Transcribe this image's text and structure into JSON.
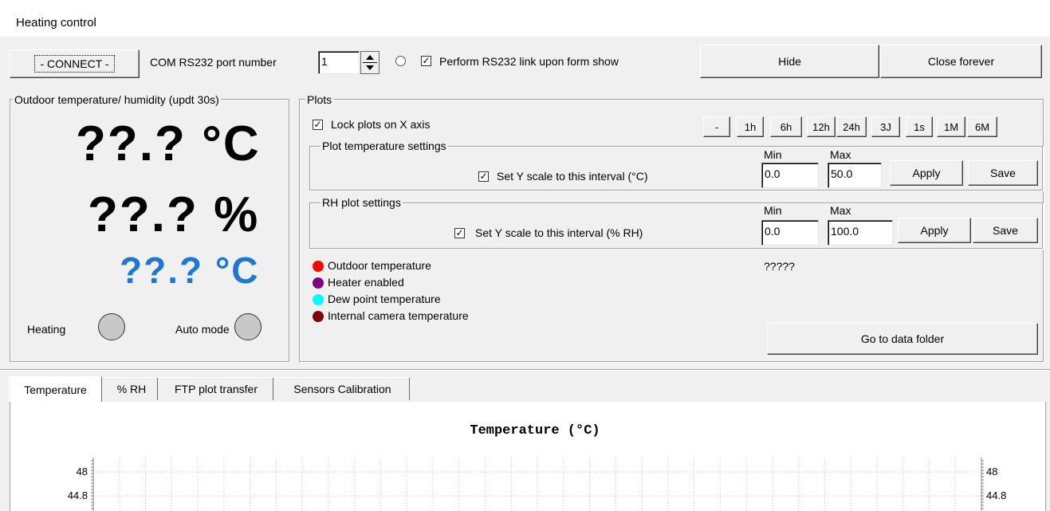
{
  "window": {
    "title": "Heating control"
  },
  "toolbar": {
    "connect_label": "- CONNECT -",
    "com_label": "COM  RS232 port number",
    "port_value": "1",
    "perform_link_label": "Perform RS232 link upon form show",
    "perform_link_checked": true,
    "hide_label": "Hide",
    "close_label": "Close forever"
  },
  "outdoor": {
    "group_title": "Outdoor temperature/ humidity (updt 30s)",
    "temperature": "??.? °C",
    "humidity": "??.? %",
    "dew_point": "??.? °C",
    "heating_label": "Heating",
    "auto_mode_label": "Auto mode"
  },
  "plots": {
    "group_title": "Plots",
    "lock_label": "Lock plots on X axis",
    "lock_checked": true,
    "range_buttons": [
      "-",
      "1h",
      "6h",
      "12h",
      "24h",
      "3J",
      "1s",
      "1M",
      "6M"
    ],
    "temp_settings": {
      "title": "Plot temperature settings",
      "set_scale_label": "Set Y scale to this interval (°C)",
      "checked": true,
      "min_label": "Min",
      "max_label": "Max",
      "min_value": "0.0",
      "max_value": "50.0",
      "apply_label": "Apply",
      "save_label": "Save"
    },
    "rh_settings": {
      "title": "RH plot settings",
      "set_scale_label": "Set Y scale to this interval (% RH)",
      "checked": true,
      "min_label": "Min",
      "max_label": "Max",
      "min_value": "0.0",
      "max_value": "100.0",
      "apply_label": "Apply",
      "save_label": "Save"
    },
    "status_text": "?????",
    "legend": [
      {
        "label": "Outdoor temperature",
        "color": "#ff0000"
      },
      {
        "label": "Heater enabled",
        "color": "#800080"
      },
      {
        "label": "Dew point temperature",
        "color": "#00ffff"
      },
      {
        "label": "Internal camera temperature",
        "color": "#800000"
      }
    ],
    "data_folder_label": "Go to data folder"
  },
  "tabs": [
    "Temperature",
    "% RH",
    "FTP plot transfer",
    "Sensors Calibration"
  ],
  "chart_data": {
    "type": "line",
    "title": "Temperature (°C)",
    "y_ticks_left": [
      "48",
      "44.8"
    ],
    "y_ticks_right": [
      "48",
      "44.8"
    ],
    "grid": true,
    "series": []
  },
  "colors": {
    "dew_point_text": "#1e78d2"
  }
}
